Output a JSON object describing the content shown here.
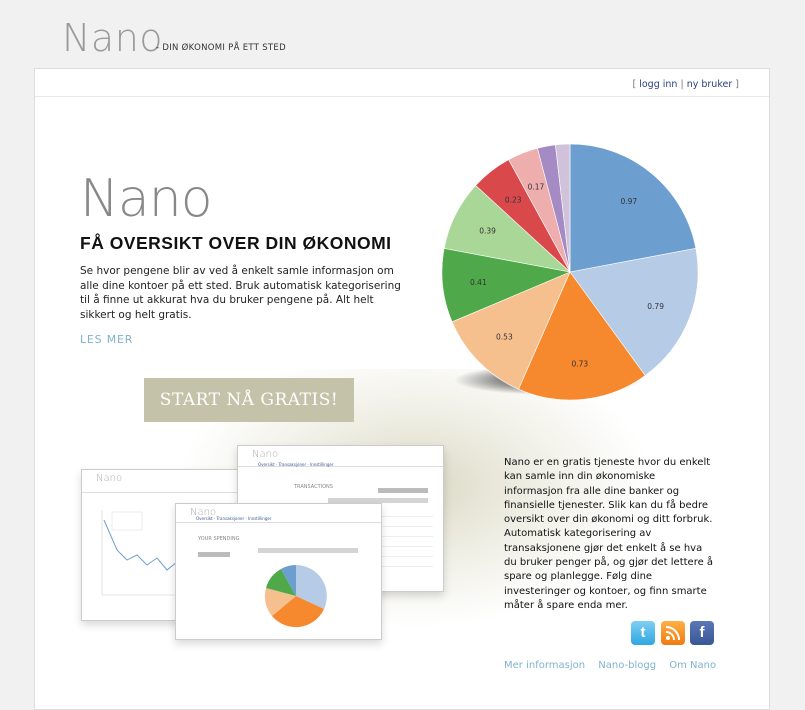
{
  "header": {
    "logo": "Nano",
    "tagline": "- DIN ØKONOMI PÅ ETT STED"
  },
  "topnav": {
    "open": "[",
    "login": "logg inn",
    "sep": "|",
    "register": "ny bruker",
    "close": "]"
  },
  "hero": {
    "big_title": "Nano",
    "heading": "FÅ OVERSIKT OVER DIN ØKONOMI",
    "paragraph": "Se hvor pengene blir av ved å enkelt samle informasjon om alle dine kontoer på ett sted. Bruk automatisk kategorisering til å finne ut akkurat hva du bruker pengene på. Alt helt sikkert og helt gratis.",
    "read_more": "LES MER",
    "cta": "START NÅ GRATIS!"
  },
  "chart_data": {
    "type": "pie",
    "values": [
      0.97,
      0.79,
      0.73,
      0.53,
      0.41,
      0.39,
      0.23,
      0.17,
      0.1,
      0.08
    ],
    "labels": [
      "0.97",
      "0.79",
      "0.73",
      "0.53",
      "0.41",
      "0.39",
      "0.23",
      "0.17",
      "",
      ""
    ],
    "colors": [
      "#6c9fcf",
      "#b6cbe6",
      "#f6892e",
      "#f6c08e",
      "#4fa84a",
      "#a9d797",
      "#d9494b",
      "#eeaeae",
      "#a58bc4",
      "#d1c2dc"
    ]
  },
  "screenshots": {
    "title": "Nano",
    "your_spending": "YOUR SPENDING",
    "transactions": "TRANSACTIONS"
  },
  "side_text": "Nano er en gratis tjeneste hvor du enkelt kan samle inn din økonomiske informasjon fra alle dine banker og finansielle tjenester. Slik kan du få bedre oversikt over din økonomi og ditt forbruk. Automatisk kategorisering av transaksjonene gjør det enkelt å se hva du bruker penger på, og gjør det lettere å spare og planlegge. Følg dine investeringer og kontoer, og finn smarte måter å spare enda mer.",
  "social": {
    "twitter": "t",
    "rss": "",
    "facebook": "f"
  },
  "footer": {
    "links": [
      "Mer informasjon",
      "Nano-blogg",
      "Om Nano"
    ]
  }
}
